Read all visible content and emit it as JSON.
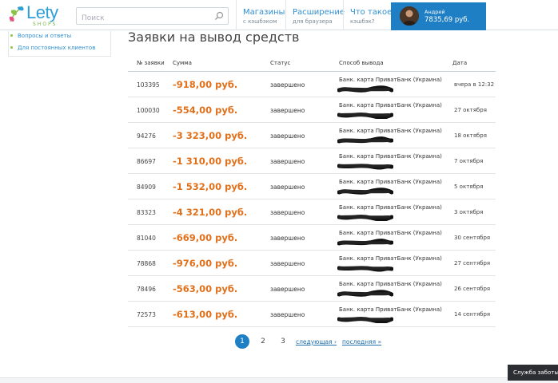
{
  "header": {
    "logo_text": "Lety",
    "logo_sub": "SHOPS",
    "search_placeholder": "Поиск",
    "nav": [
      {
        "title": "Магазины",
        "sub": "с кэшбэком"
      },
      {
        "title": "Расширение",
        "sub": "для браузера"
      },
      {
        "title": "Что такое",
        "sub": "кэшбэк?"
      }
    ],
    "user": {
      "name": "Андрей",
      "balance": "7835,69 руб."
    }
  },
  "sidebar": {
    "links": [
      "Вопросы и ответы",
      "Для постоянных клиентов"
    ]
  },
  "page": {
    "title": "Заявки на вывод средств"
  },
  "table": {
    "headers": [
      "№ заявки",
      "Сумма",
      "Статус",
      "Способ вывода",
      "Дата"
    ],
    "rows": [
      {
        "id": "103395",
        "sum": "-918,00 руб.",
        "status": "завершено",
        "method": "Банк. карта ПриватБанк (Украина)",
        "date": "вчера в 12:32"
      },
      {
        "id": "100030",
        "sum": "-554,00 руб.",
        "status": "завершено",
        "method": "Банк. карта ПриватБанк (Украина)",
        "date": "27 октября"
      },
      {
        "id": "94276",
        "sum": "-3 323,00 руб.",
        "status": "завершено",
        "method": "Банк. карта ПриватБанк (Украина)",
        "date": "18 октября"
      },
      {
        "id": "86697",
        "sum": "-1 310,00 руб.",
        "status": "завершено",
        "method": "Банк. карта ПриватБанк (Украина)",
        "date": "7 октября"
      },
      {
        "id": "84909",
        "sum": "-1 532,00 руб.",
        "status": "завершено",
        "method": "Банк. карта ПриватБанк (Украина)",
        "date": "5 октября"
      },
      {
        "id": "83323",
        "sum": "-4 321,00 руб.",
        "status": "завершено",
        "method": "Банк. карта ПриватБанк (Украина)",
        "date": "3 октября"
      },
      {
        "id": "81040",
        "sum": "-669,00 руб.",
        "status": "завершено",
        "method": "Банк. карта ПриватБанк (Украина)",
        "date": "30 сентября"
      },
      {
        "id": "78868",
        "sum": "-976,00 руб.",
        "status": "завершено",
        "method": "Банк. карта ПриватБанк (Украина)",
        "date": "27 сентября"
      },
      {
        "id": "78496",
        "sum": "-563,00 руб.",
        "status": "завершено",
        "method": "Банк. карта ПриватБанк (Украина)",
        "date": "26 сентября"
      },
      {
        "id": "72573",
        "sum": "-613,00 руб.",
        "status": "завершено",
        "method": "Банк. карта ПриватБанк (Украина)",
        "date": "14 сентября"
      }
    ]
  },
  "pager": {
    "pages": [
      "1",
      "2",
      "3"
    ],
    "next": "следующая ›",
    "last": "последняя »"
  },
  "support": {
    "label": "Служба заботы о клиентах"
  },
  "colors": {
    "accent": "#1f7fc4",
    "sum": "#e0701a",
    "link": "#2f8fd0"
  }
}
